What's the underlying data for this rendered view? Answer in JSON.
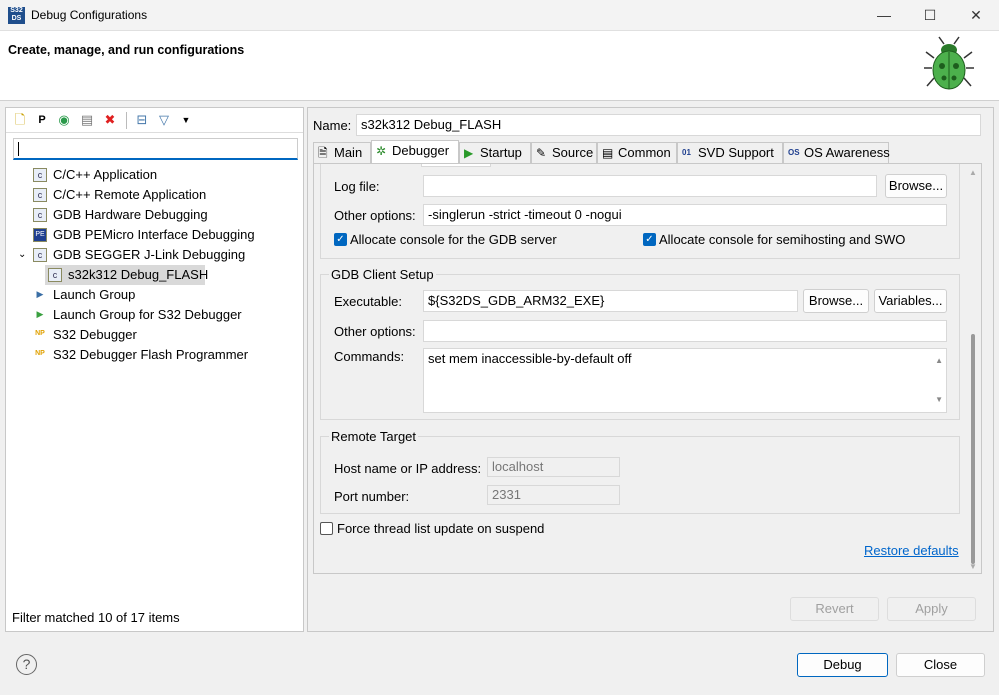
{
  "window": {
    "title": "Debug Configurations",
    "app_icon": "S32 DS",
    "minimize": "—",
    "maximize": "☐",
    "close": "✕"
  },
  "header": {
    "title": "Create, manage, and run configurations"
  },
  "left": {
    "filter_value": "",
    "toolbar": [
      "new-configuration",
      "new-prototype",
      "export",
      "duplicate",
      "delete",
      "collapse-all",
      "filter",
      "view-menu"
    ],
    "tree": [
      {
        "label": "C/C++ Application",
        "icon": "c-icon"
      },
      {
        "label": "C/C++ Remote Application",
        "icon": "c-icon"
      },
      {
        "label": "GDB Hardware Debugging",
        "icon": "c-icon"
      },
      {
        "label": "GDB PEMicro Interface Debugging",
        "icon": "pe-icon"
      },
      {
        "label": "GDB SEGGER J-Link Debugging",
        "icon": "c-icon",
        "expanded": true
      },
      {
        "label": "s32k312 Debug_FLASH",
        "icon": "c-icon",
        "child": true,
        "selected": true
      },
      {
        "label": "Launch Group",
        "icon": "launch-group-icon"
      },
      {
        "label": "Launch Group for S32 Debugger",
        "icon": "launch-group-nxp-icon"
      },
      {
        "label": "S32 Debugger",
        "icon": "nxp-icon"
      },
      {
        "label": "S32 Debugger Flash Programmer",
        "icon": "nxp-icon"
      }
    ],
    "status": "Filter matched 10 of 17 items"
  },
  "right": {
    "name_label": "Name:",
    "name_value": "s32k312 Debug_FLASH",
    "tabs": [
      {
        "label": "Main",
        "icon": "🗎"
      },
      {
        "label": "Debugger",
        "icon": "✲",
        "active": true
      },
      {
        "label": "Startup",
        "icon": "▶"
      },
      {
        "label": "Source",
        "icon": "✎"
      },
      {
        "label": "Common",
        "icon": "▤"
      },
      {
        "label": "SVD Support",
        "icon": "01"
      },
      {
        "label": "OS Awareness",
        "icon": "OS"
      }
    ],
    "server": {
      "log_label": "Log file:",
      "log_value": "",
      "browse": "Browse...",
      "other_label": "Other options:",
      "other_value": "-singlerun -strict -timeout 0 -nogui",
      "cb1": "Allocate console for the GDB server",
      "cb1_checked": true,
      "cb2": "Allocate console for semihosting and SWO",
      "cb2_checked": true
    },
    "client": {
      "title": "GDB Client Setup",
      "exe_label": "Executable:",
      "exe_value": "${S32DS_GDB_ARM32_EXE}",
      "browse": "Browse...",
      "variables": "Variables...",
      "other_label": "Other options:",
      "other_value": "",
      "commands_label": "Commands:",
      "commands_value": "set mem inaccessible-by-default off"
    },
    "remote": {
      "title": "Remote Target",
      "host_label": "Host name or IP address:",
      "host_value": "localhost",
      "port_label": "Port number:",
      "port_value": "2331"
    },
    "force_label": "Force thread list update on suspend",
    "force_checked": false,
    "restore": "Restore defaults",
    "revert": "Revert",
    "apply": "Apply"
  },
  "footer": {
    "help": "?",
    "debug": "Debug",
    "close": "Close"
  },
  "colors": {
    "accent": "#0067c0",
    "link": "#0066cc"
  }
}
